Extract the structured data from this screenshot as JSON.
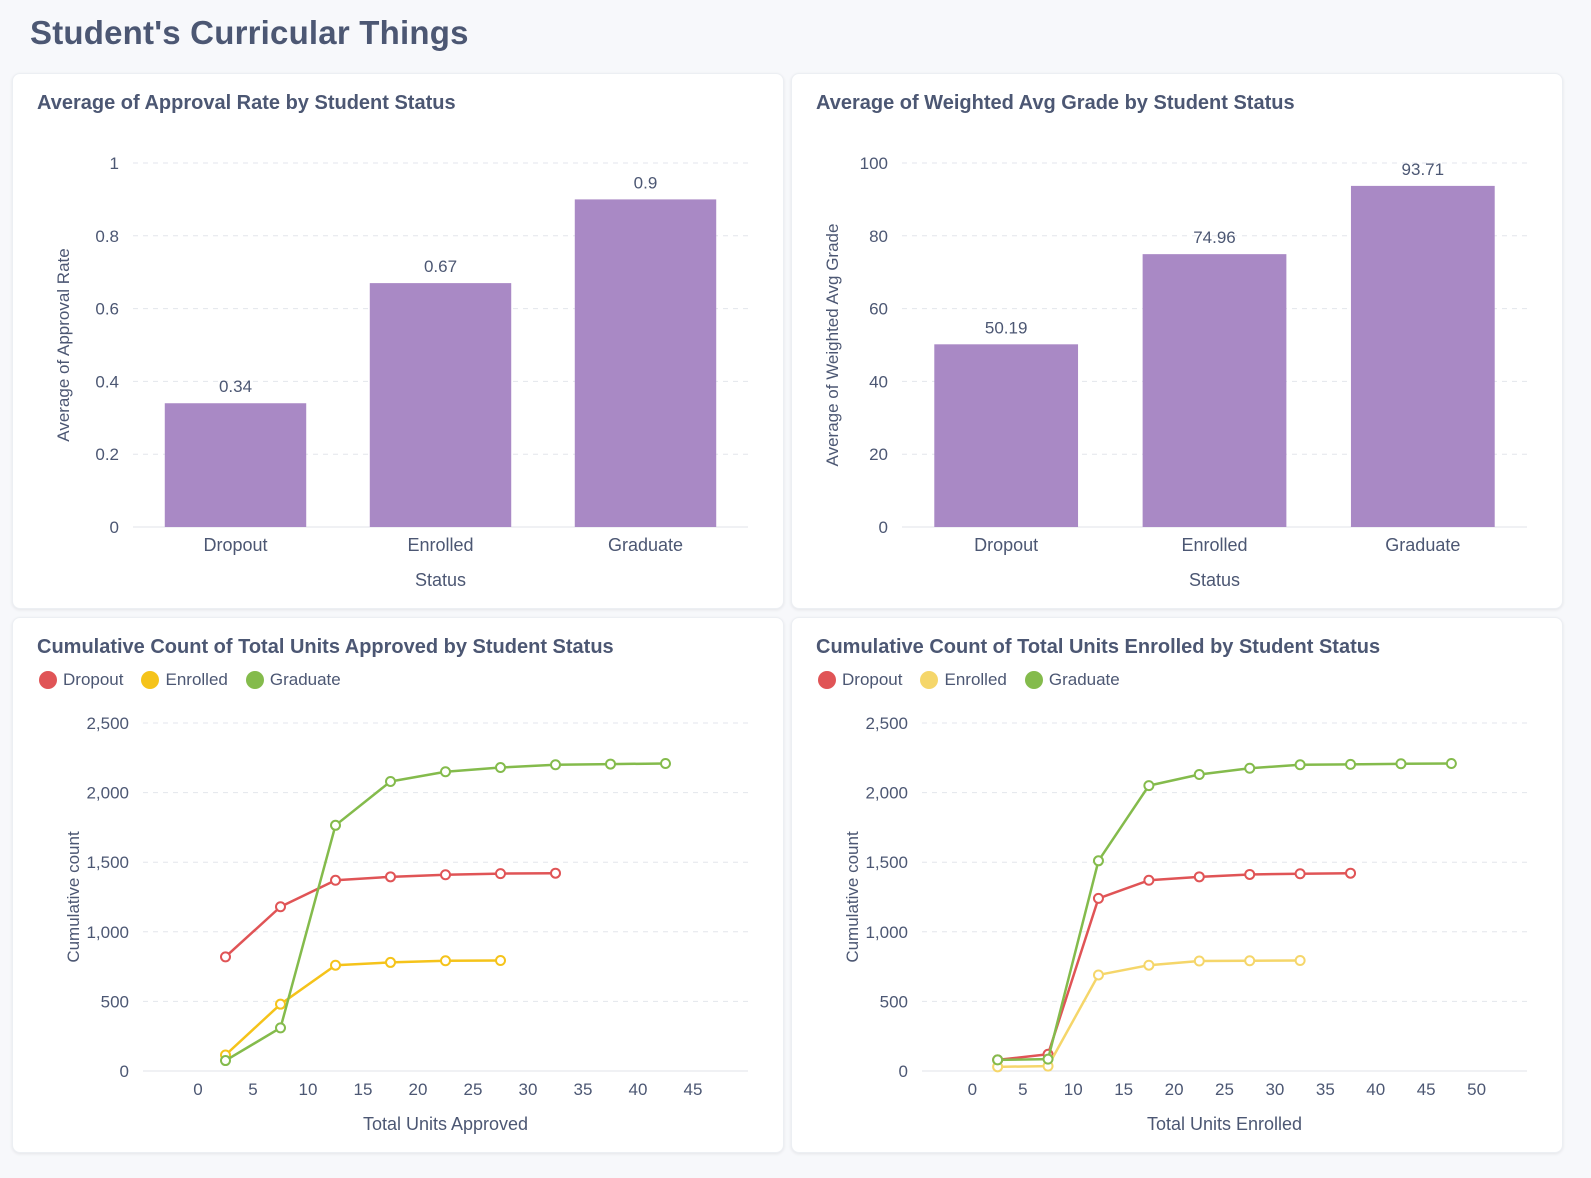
{
  "page": {
    "title": "Student's Curricular Things"
  },
  "chart_data": [
    {
      "id": "approval",
      "type": "bar",
      "title": "Average of Approval Rate by Student Status",
      "xlabel": "Status",
      "ylabel": "Average of Approval Rate",
      "categories": [
        "Dropout",
        "Enrolled",
        "Graduate"
      ],
      "values": [
        0.34,
        0.67,
        0.9
      ],
      "value_labels": [
        "0.34",
        "0.67",
        "0.9"
      ],
      "ylim": [
        0,
        1
      ],
      "yticks": [
        0,
        0.2,
        0.4,
        0.6,
        0.8,
        1
      ],
      "ytick_labels": [
        "0",
        "0.2",
        "0.4",
        "0.6",
        "0.8",
        "1"
      ],
      "color": "#a989c5",
      "grid": true
    },
    {
      "id": "grade",
      "type": "bar",
      "title": "Average of Weighted Avg Grade by Student Status",
      "xlabel": "Status",
      "ylabel": "Average of Weighted Avg Grade",
      "categories": [
        "Dropout",
        "Enrolled",
        "Graduate"
      ],
      "values": [
        50.19,
        74.96,
        93.71
      ],
      "value_labels": [
        "50.19",
        "74.96",
        "93.71"
      ],
      "ylim": [
        0,
        100
      ],
      "yticks": [
        0,
        20,
        40,
        60,
        80,
        100
      ],
      "ytick_labels": [
        "0",
        "20",
        "40",
        "60",
        "80",
        "100"
      ],
      "color": "#a989c5",
      "grid": true
    },
    {
      "id": "approved",
      "type": "line",
      "title": "Cumulative Count of Total Units Approved by Student Status",
      "xlabel": "Total Units Approved",
      "ylabel": "Cumulative count",
      "xlim": [
        -5,
        50
      ],
      "xticks": [
        0,
        5,
        10,
        15,
        20,
        25,
        30,
        35,
        40,
        45
      ],
      "ylim": [
        0,
        2500
      ],
      "yticks": [
        0,
        500,
        1000,
        1500,
        2000,
        2500
      ],
      "ytick_labels": [
        "0",
        "500",
        "1,000",
        "1,500",
        "2,000",
        "2,500"
      ],
      "legend_position": "top-left",
      "grid": true,
      "series": [
        {
          "name": "Dropout",
          "color": "#e05456",
          "x": [
            2.5,
            7.5,
            12.5,
            17.5,
            22.5,
            27.5,
            32.5
          ],
          "y": [
            820,
            1180,
            1370,
            1395,
            1410,
            1418,
            1421
          ]
        },
        {
          "name": "Enrolled",
          "color": "#f5c31a",
          "x": [
            2.5,
            7.5,
            12.5,
            17.5,
            22.5,
            27.5
          ],
          "y": [
            115,
            480,
            760,
            780,
            792,
            794
          ]
        },
        {
          "name": "Graduate",
          "color": "#84bb4c",
          "x": [
            2.5,
            7.5,
            12.5,
            17.5,
            22.5,
            27.5,
            32.5,
            37.5,
            42.5
          ],
          "y": [
            75,
            310,
            1765,
            2080,
            2150,
            2180,
            2200,
            2205,
            2209
          ]
        }
      ]
    },
    {
      "id": "enrolled",
      "type": "line",
      "title": "Cumulative Count of Total Units Enrolled by Student Status",
      "xlabel": "Total Units Enrolled",
      "ylabel": "Cumulative count",
      "xlim": [
        -5,
        55
      ],
      "xticks": [
        0,
        5,
        10,
        15,
        20,
        25,
        30,
        35,
        40,
        45,
        50
      ],
      "ylim": [
        0,
        2500
      ],
      "yticks": [
        0,
        500,
        1000,
        1500,
        2000,
        2500
      ],
      "ytick_labels": [
        "0",
        "500",
        "1,000",
        "1,500",
        "2,000",
        "2,500"
      ],
      "legend_position": "top-left",
      "grid": true,
      "series": [
        {
          "name": "Dropout",
          "color": "#e05456",
          "x": [
            2.5,
            7.5,
            12.5,
            17.5,
            22.5,
            27.5,
            32.5,
            37.5
          ],
          "y": [
            80,
            120,
            1240,
            1370,
            1395,
            1412,
            1417,
            1421
          ]
        },
        {
          "name": "Enrolled",
          "color": "#f5d66a",
          "x": [
            2.5,
            7.5,
            12.5,
            17.5,
            22.5,
            27.5,
            32.5
          ],
          "y": [
            30,
            35,
            690,
            760,
            790,
            792,
            794
          ]
        },
        {
          "name": "Graduate",
          "color": "#84bb4c",
          "x": [
            2.5,
            7.5,
            12.5,
            17.5,
            22.5,
            27.5,
            32.5,
            37.5,
            42.5,
            47.5
          ],
          "y": [
            80,
            85,
            1510,
            2050,
            2130,
            2175,
            2200,
            2203,
            2207,
            2209
          ]
        }
      ]
    }
  ]
}
